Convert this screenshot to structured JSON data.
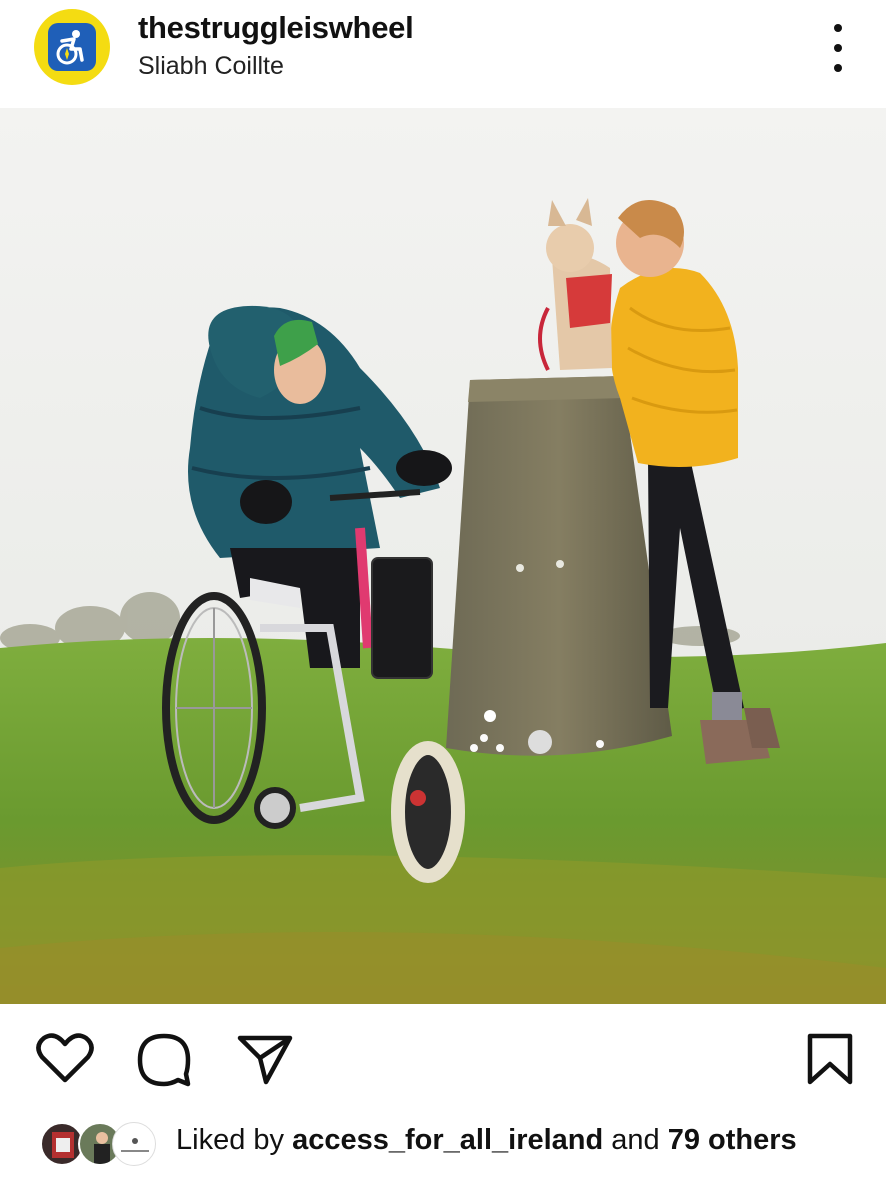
{
  "post": {
    "username": "thestruggleiswheel",
    "location": "Sliabh Coillte"
  },
  "header": {
    "avatar_icon": "wheelchair-compass-icon",
    "more_icon": "more-options-icon"
  },
  "photo": {
    "subject": "post-photo"
  },
  "actions": {
    "like_icon": "heart-icon",
    "comment_icon": "comment-icon",
    "share_icon": "send-icon",
    "save_icon": "bookmark-icon"
  },
  "likes": {
    "prefix": "Liked by ",
    "user": "access_for_all_ireland",
    "middle": " and ",
    "count": "79",
    "suffix": " others"
  },
  "colors": {
    "avatar_ring": "#f4dc12",
    "avatar_fill": "#1f5fb8",
    "text": "#111111"
  }
}
